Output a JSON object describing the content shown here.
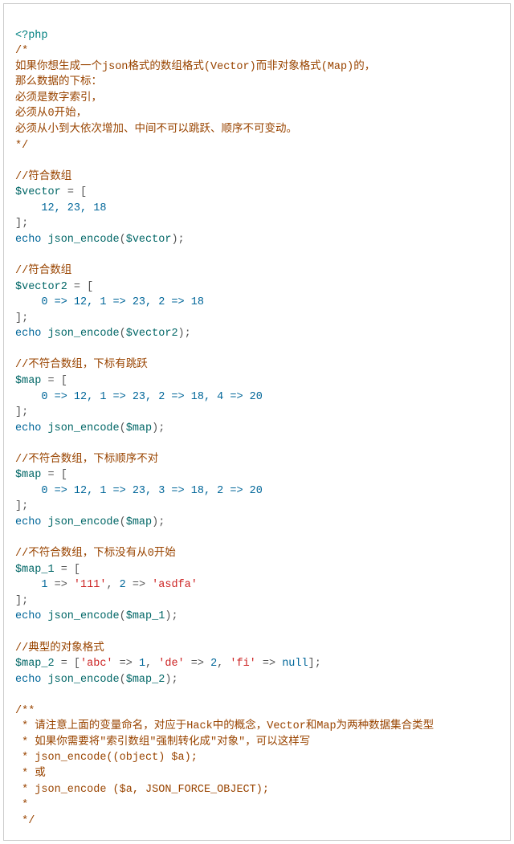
{
  "php_open": "<?php",
  "block1": {
    "l1": "/*",
    "l2": "如果你想生成一个json格式的数组格式(Vector)而非对象格式(Map)的，",
    "l3": "那么数据的下标：",
    "l4": "必须是数字索引，",
    "l5": "必须从0开始，",
    "l6": "必须从小到大依次增加、中间不可以跳跃、顺序不可变动。",
    "l7": "*/"
  },
  "sec1": {
    "comment": "//符合数组",
    "var": "$vector",
    "eq": " = [",
    "vals": "    12, 23, 18",
    "close": "];",
    "echo": "echo",
    "fn": " json_encode",
    "open": "(",
    "arg": "$vector",
    "end": ");"
  },
  "sec2": {
    "comment": "//符合数组",
    "var": "$vector2",
    "eq": " = [",
    "vals": "    0 => 12, 1 => 23, 2 => 18",
    "close": "];",
    "echo": "echo",
    "fn": " json_encode",
    "open": "(",
    "arg": "$vector2",
    "end": ");"
  },
  "sec3": {
    "comment": "//不符合数组，下标有跳跃",
    "var": "$map",
    "eq": " = [",
    "vals": "    0 => 12, 1 => 23, 2 => 18, 4 => 20",
    "close": "];",
    "echo": "echo",
    "fn": " json_encode",
    "open": "(",
    "arg": "$map",
    "end": ");"
  },
  "sec4": {
    "comment": "//不符合数组，下标顺序不对",
    "var": "$map",
    "eq": " = [",
    "vals": "    0 => 12, 1 => 23, 3 => 18, 2 => 20",
    "close": "];",
    "echo": "echo",
    "fn": " json_encode",
    "open": "(",
    "arg": "$map",
    "end": ");"
  },
  "sec5": {
    "comment": "//不符合数组，下标没有从0开始",
    "var": "$map_1",
    "eq": " = [",
    "pre": "    ",
    "k1": "1",
    "arrow": " => ",
    "s1": "'111'",
    "comma": ", ",
    "k2": "2",
    "s2": "'asdfa'",
    "close": "];",
    "echo": "echo",
    "fn": " json_encode",
    "open": "(",
    "arg": "$map_1",
    "end": ");"
  },
  "sec6": {
    "comment": "//典型的对象格式",
    "var": "$map_2",
    "eq": " = [",
    "s1": "'abc'",
    "arrow": " => ",
    "n1": "1",
    "comma": ", ",
    "s2": "'de'",
    "n2": "2",
    "s3": "'fi'",
    "null": "null",
    "close": "];",
    "echo": "echo",
    "fn": " json_encode",
    "open": "(",
    "arg": "$map_2",
    "end": ");"
  },
  "block2": {
    "l1": "/**",
    "l2": " * 请注意上面的变量命名，对应于Hack中的概念，Vector和Map为两种数据集合类型",
    "l3": " * 如果你需要将\"索引数组\"强制转化成\"对象\"，可以这样写",
    "l4": " * json_encode((object) $a);",
    "l5": " * 或",
    "l6": " * json_encode ($a, JSON_FORCE_OBJECT);",
    "l7": " *",
    "l8": " */"
  }
}
